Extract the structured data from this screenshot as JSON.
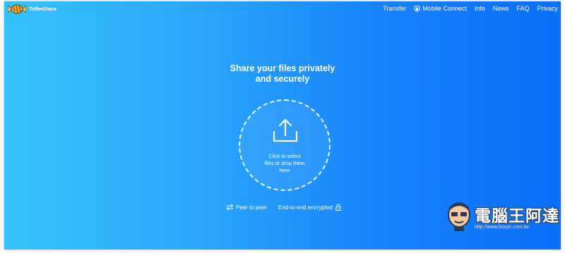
{
  "brand": {
    "name": "ToffeeShare",
    "logo_icon": "toffee-candy-icon"
  },
  "nav": {
    "items": [
      {
        "label": "Transfer"
      },
      {
        "label": "Mobile Connect",
        "icon": "mobile-connect-icon"
      },
      {
        "label": "Info"
      },
      {
        "label": "News"
      },
      {
        "label": "FAQ"
      },
      {
        "label": "Privacy"
      }
    ]
  },
  "hero": {
    "title_line1": "Share your files privately",
    "title_line2": "and securely"
  },
  "dropzone": {
    "icon": "upload-icon",
    "text_line1": "Click to select",
    "text_line2": "files or drop them",
    "text_line3": "here"
  },
  "features": [
    {
      "label": "Peer to peer",
      "icon": "swap-arrows-icon"
    },
    {
      "label": "End-to-end encrypted",
      "icon": "lock-icon"
    }
  ],
  "watermark": {
    "title": "電腦王阿達",
    "url": "http://www.kocpc.com.tw"
  },
  "colors": {
    "gradient_start": "#35c3fb",
    "gradient_end": "#0a6ffa",
    "text": "#ffffff"
  }
}
